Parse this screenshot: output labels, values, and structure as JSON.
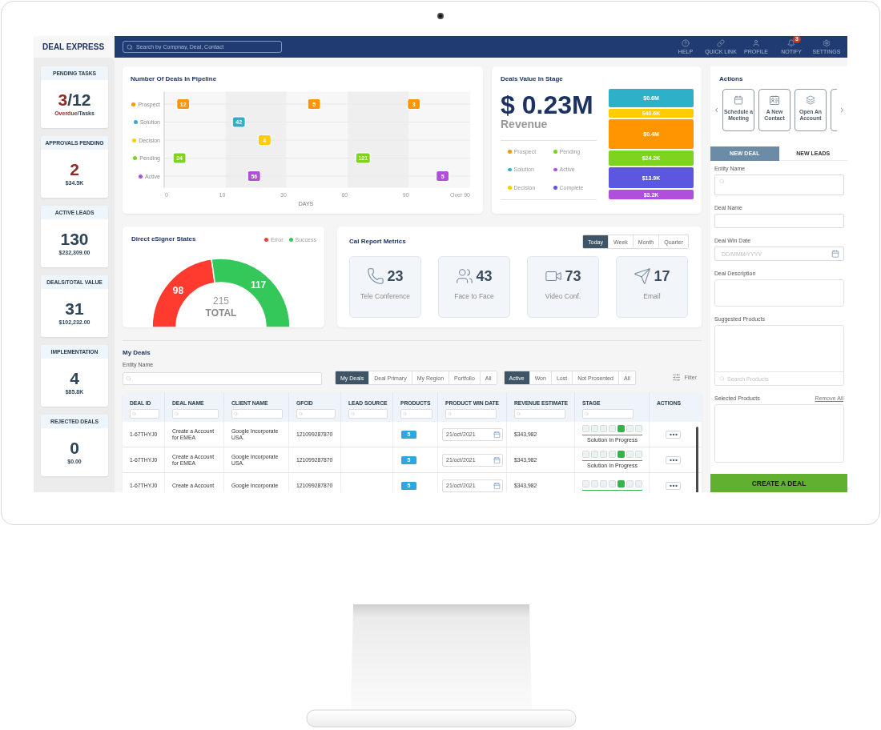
{
  "app": {
    "logo": "DEAL EXPRESS",
    "search": {
      "placeholder": "Search by Compnay, Deal, Contact"
    },
    "nav": [
      {
        "label": "HELP"
      },
      {
        "label": "QUICK LINK"
      },
      {
        "label": "PROFILE"
      },
      {
        "label": "NOTIFY",
        "badge": "3"
      },
      {
        "label": "SETTINGS"
      }
    ]
  },
  "stats": [
    {
      "kind": "ratio",
      "title": "PENDING TASKS",
      "value": "3",
      "total": "/12",
      "caption": "Overdue",
      "caption_rest": "/Tasks"
    },
    {
      "kind": "amount",
      "title": "APPROVALS PENDING",
      "value": "2",
      "amount": "$34.5K",
      "alert": true
    },
    {
      "kind": "amount",
      "title": "ACTIVE LEADS",
      "value": "130",
      "amount": "$232,309.00",
      "alert": false
    },
    {
      "kind": "amount",
      "title": "DEALS/TOTAL VALUE",
      "value": "31",
      "amount": "$102,232.00",
      "alert": false
    },
    {
      "kind": "amount",
      "title": "IMPLEMENTATION",
      "value": "4",
      "amount": "$85.8K",
      "alert": false
    },
    {
      "kind": "amount",
      "title": "REJECTED DEALS",
      "value": "0",
      "amount": "$0.00",
      "alert": false
    }
  ],
  "pipeline": {
    "title": "Number Of Deals In Pipeline",
    "stages": [
      {
        "label": "Prospect",
        "color": "#ff9500",
        "cells": [
          {
            "kind": "count",
            "value": "12"
          },
          {
            "kind": "empty"
          },
          {
            "kind": "count",
            "value": "5"
          },
          {
            "kind": "empty"
          },
          {
            "kind": "count",
            "value": "3"
          }
        ]
      },
      {
        "label": "Solution",
        "color": "#2eb0c8",
        "cells": [
          {
            "kind": "empty"
          },
          {
            "kind": "count",
            "value": "42"
          },
          {
            "kind": "empty"
          },
          {
            "kind": "empty"
          },
          {
            "kind": "empty"
          }
        ]
      },
      {
        "label": "Decision",
        "color": "#ffcc00",
        "cells": [
          {
            "kind": "empty"
          },
          {
            "kind": "count",
            "value": "4"
          },
          {
            "kind": "empty"
          },
          {
            "kind": "empty"
          },
          {
            "kind": "empty"
          }
        ]
      },
      {
        "label": "Pending",
        "color": "#7ed321",
        "cells": [
          {
            "kind": "count",
            "value": "24"
          },
          {
            "kind": "empty"
          },
          {
            "kind": "empty"
          },
          {
            "kind": "count",
            "value": "121"
          },
          {
            "kind": "empty"
          }
        ]
      },
      {
        "label": "Active",
        "color": "#b04fdc",
        "cells": [
          {
            "kind": "empty"
          },
          {
            "kind": "count",
            "value": "56"
          },
          {
            "kind": "empty"
          },
          {
            "kind": "empty"
          },
          {
            "kind": "count",
            "value": "5"
          }
        ]
      }
    ],
    "ticks": [
      "0",
      "10",
      "30",
      "60",
      "90",
      "Over 90"
    ],
    "axis_title": "DAYS"
  },
  "deal_value": {
    "title": "Deals Value In Stage",
    "total": "$ 0.23M",
    "caption": "Revenue",
    "legend": [
      {
        "label": "Prospect",
        "color": "#ff9500"
      },
      {
        "label": "Pending",
        "color": "#7ed321"
      },
      {
        "label": "Solution",
        "color": "#2eb0c8"
      },
      {
        "label": "Active",
        "color": "#b04fdc"
      },
      {
        "label": "Decision",
        "color": "#ffcc00"
      },
      {
        "label": "Complete",
        "color": "#5b57e0"
      }
    ],
    "blocks": [
      {
        "value": "$0.6M",
        "color": "#2eb0c8"
      },
      {
        "value": "$40.6K",
        "color": "#ffcc00"
      },
      {
        "value": "$0.4M",
        "color": "#ff9500"
      },
      {
        "value": "$24.2K",
        "color": "#7ed321"
      },
      {
        "value": "$13.9K",
        "color": "#5b57e0"
      },
      {
        "value": "$3.2K",
        "color": "#b04fdc"
      }
    ]
  },
  "esigner": {
    "title": "Direct eSigner States",
    "chart_data": {
      "type": "donut",
      "data_labels": true,
      "categories": [
        "Error",
        "Success"
      ],
      "values": [
        98,
        117
      ],
      "colors": [
        "#ff3b30",
        "#34c759"
      ]
    },
    "total": "215",
    "total_label": "TOTAL"
  },
  "cal_report": {
    "title": "Cal Report Metrics",
    "periods": [
      {
        "label": "Today",
        "selected": true
      },
      {
        "label": "Week",
        "selected": false
      },
      {
        "label": "Month",
        "selected": false
      },
      {
        "label": "Quarter",
        "selected": false
      }
    ],
    "metrics": [
      {
        "value": "23",
        "label": "Tele Conference"
      },
      {
        "value": "43",
        "label": "Face to Face"
      },
      {
        "value": "73",
        "label": "Video Conf."
      },
      {
        "value": "17",
        "label": "Email"
      }
    ]
  },
  "my_deals": {
    "title": "My Deals",
    "entity_label": "Entity Name",
    "scopes": [
      {
        "label": "My Deals",
        "selected": true
      },
      {
        "label": "Deal Primary",
        "selected": false
      },
      {
        "label": "My Region",
        "selected": false
      },
      {
        "label": "Portfolio",
        "selected": false
      },
      {
        "label": "All",
        "selected": false
      }
    ],
    "statuses": [
      {
        "label": "Active",
        "selected": true
      },
      {
        "label": "Won",
        "selected": false
      },
      {
        "label": "Lost",
        "selected": false
      },
      {
        "label": "Not Prosented",
        "selected": false
      },
      {
        "label": "All",
        "selected": false
      }
    ],
    "filter_label": "Filter",
    "columns": [
      {
        "label": "DEAL ID",
        "filter": true
      },
      {
        "label": "DEAL NAME",
        "filter": true
      },
      {
        "label": "CLIENT NAME",
        "filter": true
      },
      {
        "label": "GFCID",
        "filter": true
      },
      {
        "label": "LEAD SOURCE",
        "filter": true
      },
      {
        "label": "PRODUCTS",
        "filter": true
      },
      {
        "label": "PRODUCT WIN DATE",
        "filter": true
      },
      {
        "label": "REVENUE ESTIMATE",
        "filter": true
      },
      {
        "label": "STAGE",
        "filter": true
      },
      {
        "label": "ACTIONS",
        "filter": false
      }
    ],
    "rows": [
      {
        "deal_id": "1-67THYJ0",
        "deal_name": "Create a Account for EMEA",
        "client": "Google Incorporate USA.",
        "gfcid": "121099287870",
        "products": "5",
        "win_date": "21/oct/2021",
        "revenue": "$343,982",
        "stage_steps": [
          {
            "selected": false
          },
          {
            "selected": false
          },
          {
            "selected": false
          },
          {
            "selected": false
          },
          {
            "selected": true
          },
          {
            "selected": false
          },
          {
            "selected": false
          }
        ],
        "stage_label": "Solution In Progress"
      },
      {
        "deal_id": "1-67THYJ0",
        "deal_name": "Create a Account for EMEA",
        "client": "Google Incorporate USA.",
        "gfcid": "121099287870",
        "products": "5",
        "win_date": "21/oct/2021",
        "revenue": "$343,982",
        "stage_steps": [
          {
            "selected": false
          },
          {
            "selected": false
          },
          {
            "selected": false
          },
          {
            "selected": false
          },
          {
            "selected": true
          },
          {
            "selected": false
          },
          {
            "selected": false
          }
        ],
        "stage_label": "Solution In Progress"
      },
      {
        "deal_id": "1-67THYJ0",
        "deal_name": "Create a Account",
        "client": "Google Incorporate",
        "gfcid": "121099287870",
        "products": "5",
        "win_date": "21/oct/2021",
        "revenue": "$343,982",
        "stage_steps": [
          {
            "selected": false
          },
          {
            "selected": false
          },
          {
            "selected": false
          },
          {
            "selected": false
          },
          {
            "selected": true
          },
          {
            "selected": false
          },
          {
            "selected": false
          }
        ]
      }
    ]
  },
  "side_panel": {
    "title": "Actions",
    "actions": [
      {
        "label": "Schedule a Meeting"
      },
      {
        "label": "A New Contact"
      },
      {
        "label": "Open An Account"
      }
    ],
    "tabs": [
      {
        "label": "NEW DEAL",
        "selected": true
      },
      {
        "label": "NEW LEADS",
        "selected": false
      }
    ],
    "fields": [
      {
        "kind": "search",
        "label": "Entity Name"
      },
      {
        "kind": "text",
        "label": "Deal Name"
      },
      {
        "kind": "date",
        "label": "Deal Win Date",
        "placeholder": "DD/MMM/YYYY"
      },
      {
        "kind": "textarea",
        "label": "Deal Description"
      },
      {
        "kind": "picker",
        "label": "Suggested Products",
        "placeholder": "Search Products"
      },
      {
        "kind": "list",
        "label": "Selected Products",
        "link": "Remove All"
      }
    ],
    "submit": "CREATE A DEAL"
  }
}
